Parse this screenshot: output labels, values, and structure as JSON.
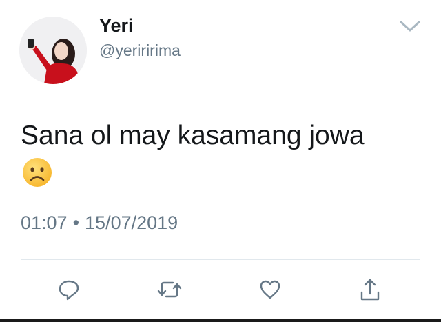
{
  "user": {
    "display_name": "Yeri",
    "handle": "@yeriririma",
    "avatar": "profile-photo-avatar"
  },
  "tweet": {
    "text": "Sana ol may kasamang jowa",
    "emoji": "frowning-face-emoji",
    "time": "01:07",
    "separator": "•",
    "date": "15/07/2019"
  },
  "icons": {
    "menu": "chevron-down-icon",
    "reply": "reply-icon",
    "retweet": "retweet-icon",
    "like": "heart-icon",
    "share": "share-icon"
  },
  "colors": {
    "primary_text": "#14171a",
    "secondary_text": "#657786",
    "icon": "#657786",
    "divider": "#e1e8ed",
    "emoji_face": "#ffc83d"
  }
}
